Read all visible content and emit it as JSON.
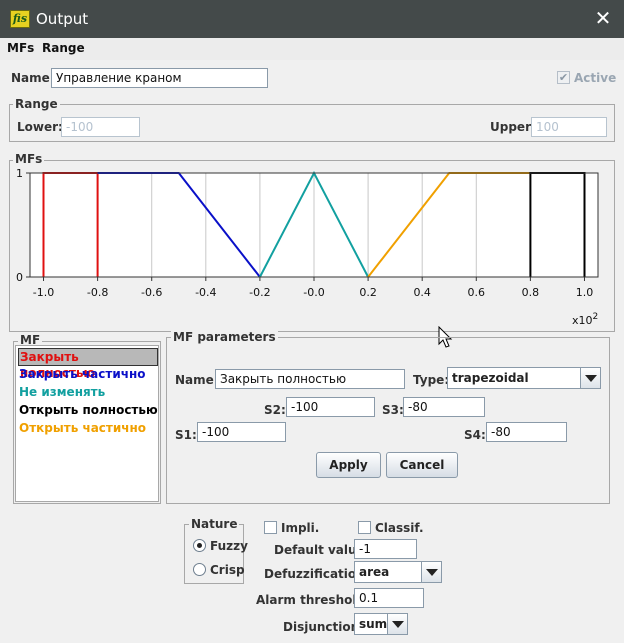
{
  "window": {
    "title": "Output",
    "close_glyph": "✕",
    "app_icon_text": "fis"
  },
  "menu": [
    {
      "label": "MFs"
    },
    {
      "label": "Range"
    }
  ],
  "name_row": {
    "label": "Name:",
    "value": "Управление краном",
    "active_label": "Active",
    "active_check": "✔"
  },
  "range": {
    "title": "Range",
    "lower_label": "Lower:",
    "lower_value": "-100",
    "upper_label": "Upper:",
    "upper_value": "100"
  },
  "mfs_group": {
    "title": "MFs"
  },
  "chart_data": {
    "type": "line",
    "xlim": [
      -1.05,
      1.05
    ],
    "ylim": [
      0,
      1
    ],
    "x_ticks": [
      "-1.0",
      "-0.8",
      "-0.6",
      "-0.4",
      "-0.2",
      "-0.0",
      "0.2",
      "0.4",
      "0.6",
      "0.8",
      "1.0"
    ],
    "x_tick_values": [
      -1.0,
      -0.8,
      -0.6,
      -0.4,
      -0.2,
      0.0,
      0.2,
      0.4,
      0.6,
      0.8,
      1.0
    ],
    "y_ticks": [
      "0",
      "1"
    ],
    "y_tick_values": [
      0,
      1
    ],
    "scale_label": "x10",
    "scale_exp": "2",
    "grid": true,
    "series": [
      {
        "name": "Закрыть полностью",
        "color": "#e01010",
        "x": [
          -1.0,
          -1.0,
          -0.8,
          -0.8
        ],
        "y": [
          0,
          1,
          1,
          0
        ]
      },
      {
        "name": "Закрыть частично",
        "color": "#0a10c8",
        "x": [
          -0.8,
          -0.5,
          -0.2
        ],
        "y": [
          1,
          1,
          0
        ]
      },
      {
        "name": "Не изменять",
        "color": "#12a0a0",
        "x": [
          -0.2,
          0.0,
          0.2
        ],
        "y": [
          0,
          1,
          0
        ]
      },
      {
        "name": "Открыть частично",
        "color": "#f0a000",
        "x": [
          0.2,
          0.5,
          0.8
        ],
        "y": [
          0,
          1,
          1
        ]
      },
      {
        "name": "Открыть полностью",
        "color": "#000000",
        "x": [
          0.8,
          0.8,
          1.0,
          1.0
        ],
        "y": [
          0,
          1,
          1,
          0
        ]
      }
    ]
  },
  "mf_list": {
    "title": "MF",
    "items": [
      {
        "label": "Закрыть полностью",
        "color": "#e01010"
      },
      {
        "label": "Закрыть частично",
        "color": "#0a10c8"
      },
      {
        "label": "Не изменять",
        "color": "#12a0a0"
      },
      {
        "label": "Открыть полностью",
        "color": "#000000"
      },
      {
        "label": "Открыть частично",
        "color": "#f0a000"
      }
    ],
    "selected_index": 0
  },
  "mf_params": {
    "title": "MF parameters",
    "name_label": "Name:",
    "name_value": "Закрыть полностью",
    "type_label": "Type:",
    "type_value": "trapezoidal",
    "s1_label": "S1:",
    "s1_value": "-100",
    "s2_label": "S2:",
    "s2_value": "-100",
    "s3_label": "S3:",
    "s3_value": "-80",
    "s4_label": "S4:",
    "s4_value": "-80",
    "apply_label": "Apply",
    "cancel_label": "Cancel"
  },
  "nature": {
    "title": "Nature",
    "fuzzy_label": "Fuzzy",
    "crisp_label": "Crisp",
    "selected": "Fuzzy"
  },
  "options": {
    "impli_label": "Impli.",
    "classif_label": "Classif.",
    "default_label": "Default value:",
    "default_value": "-1",
    "defuzz_label": "Defuzzification:",
    "defuzz_value": "area",
    "alarm_label": "Alarm threshold:",
    "alarm_value": "0.1",
    "disjunction_label": "Disjunction:",
    "disjunction_value": "sum"
  }
}
